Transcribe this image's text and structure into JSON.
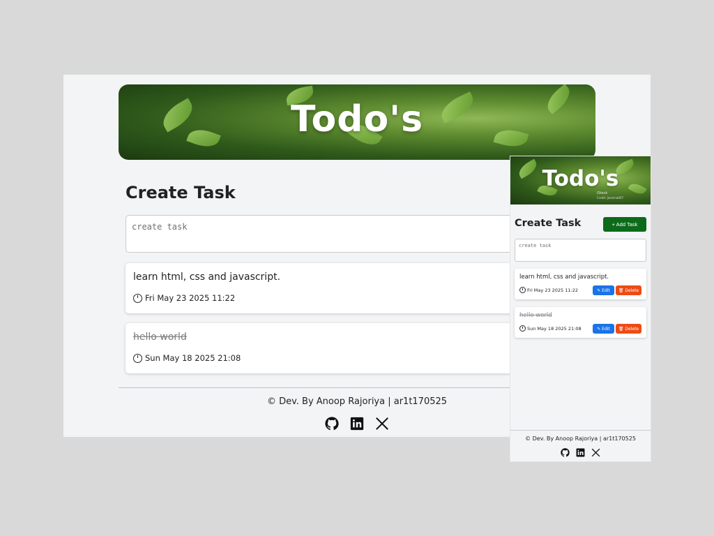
{
  "app": {
    "title": "Todo's",
    "heading": "Create Task",
    "input_placeholder": "create task",
    "add_button": "+ Add Task",
    "tasks": [
      {
        "text": "learn html, css and javascript.",
        "date": "Fri May 23 2025 11:22",
        "done": false
      },
      {
        "text": "hello world",
        "date": "Sun May 18 2025 21:08",
        "done": true
      }
    ],
    "edit_label": "✎ Edit",
    "delete_label": "🗑 Delete",
    "footer": "© Dev. By Anoop Rajoriya | ar1t170525",
    "social": [
      "github-icon",
      "linkedin-icon",
      "x-icon"
    ]
  },
  "mobile": {
    "banner_watermark": "iStock",
    "banner_credit": "Credit: Jasmina007"
  },
  "colors": {
    "add_button": "#0b6b1a",
    "edit_button": "#1a73e8",
    "delete_button": "#ee4b14",
    "background": "#f3f4f6"
  }
}
